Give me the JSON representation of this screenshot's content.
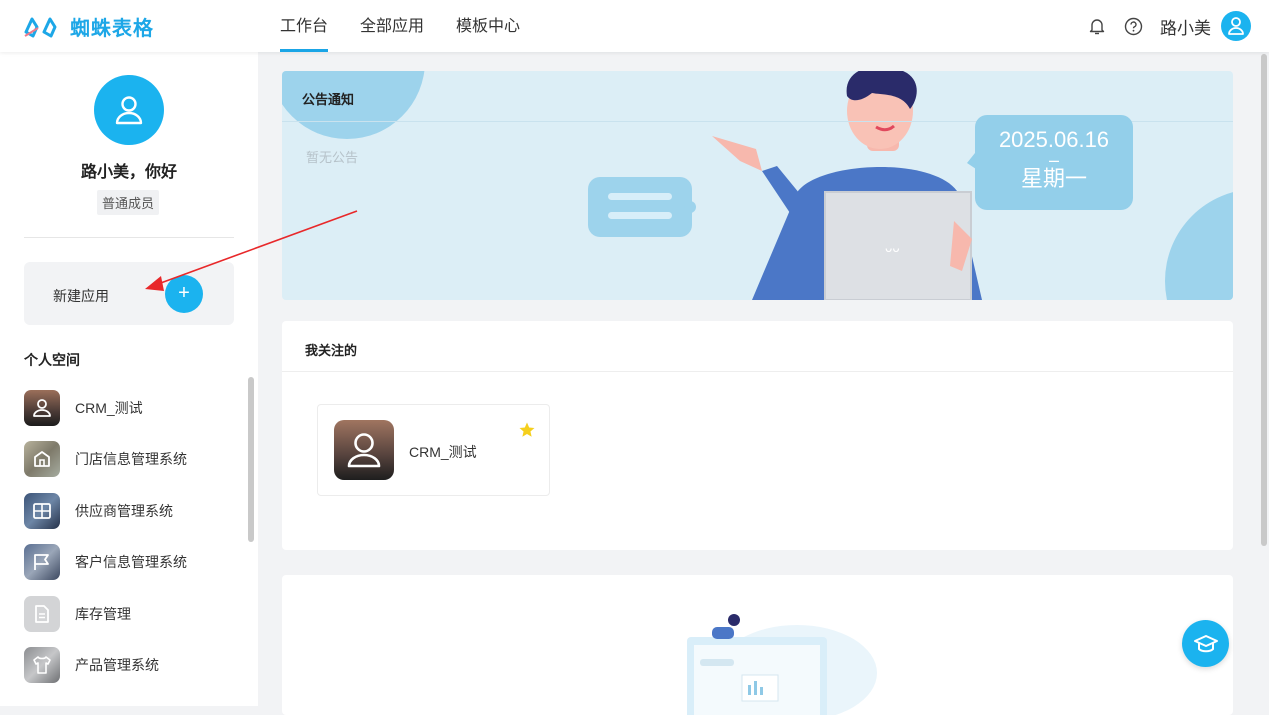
{
  "header": {
    "brand": "蜘蛛表格",
    "nav": [
      "工作台",
      "全部应用",
      "模板中心"
    ],
    "username": "路小美",
    "accent": "#1aa5e6"
  },
  "sidebar": {
    "greeting": "路小美，你好",
    "role": "普通成员",
    "new_app_label": "新建应用",
    "new_app_plus": "+",
    "section_title": "个人空间",
    "apps": [
      {
        "name": "CRM_测试",
        "icon": "user-icon"
      },
      {
        "name": "门店信息管理系统",
        "icon": "store-icon"
      },
      {
        "name": "供应商管理系统",
        "icon": "grid-icon"
      },
      {
        "name": "客户信息管理系统",
        "icon": "flag-icon"
      },
      {
        "name": "库存管理",
        "icon": "document-icon"
      },
      {
        "name": "产品管理系统",
        "icon": "shirt-icon"
      }
    ]
  },
  "announcement": {
    "title": "公告通知",
    "empty_text": "暂无公告",
    "date": "2025.06.16",
    "dash": "–",
    "weekday": "星期一"
  },
  "following": {
    "title": "我关注的",
    "items": [
      {
        "name": "CRM_测试",
        "starred": true
      }
    ]
  },
  "colors": {
    "primary": "#1bb3ef",
    "star": "#f5cf1d",
    "annotation_arrow": "#e8282a"
  }
}
